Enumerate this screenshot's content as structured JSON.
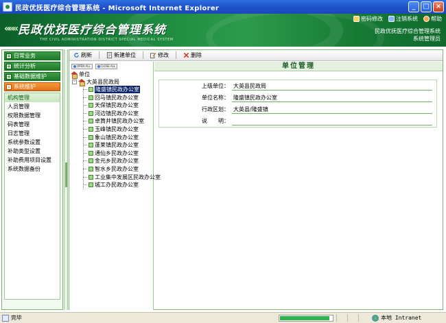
{
  "window": {
    "title": "民政优抚医疗综合管理系统 - Microsoft Internet Explorer"
  },
  "banner": {
    "title": "民政优抚医疗综合管理系统",
    "subtitle": "THE CIVIL ADMINISTRATION DISTRICT SPECIAL MEDICAL SYSTEM",
    "links": [
      {
        "label": "密码修改",
        "icon": "key-icon"
      },
      {
        "label": "注销系统",
        "icon": "logout-icon"
      },
      {
        "label": "帮助",
        "icon": "help-icon"
      }
    ],
    "system_name": "民政优抚医疗综合管理系统",
    "user": "系统管理员"
  },
  "leftnav": {
    "menus": [
      {
        "label": "日常业务",
        "active": false
      },
      {
        "label": "统计分析",
        "active": false
      },
      {
        "label": "基础数据维护",
        "active": false
      },
      {
        "label": "系统维护",
        "active": true
      }
    ],
    "subitems": [
      "机构管理",
      "人员管理",
      "权限数据管理",
      "码表管理",
      "日志管理",
      "系统参数设置",
      "补助类型设置",
      "补助费用项目设置",
      "系统数据备份"
    ]
  },
  "toolbar": {
    "refresh": "刷新",
    "new_unit": "新建单位",
    "edit": "修改",
    "delete": "删除"
  },
  "tree": {
    "open_all": "OPEN ALL",
    "close_all": "CLOSE ALL",
    "root": "单位",
    "county": "大英县民政局",
    "nodes": [
      "隆盛镇民政办公室",
      "回马镇民政办公室",
      "天保镇民政办公室",
      "河边镇民政办公室",
      "卓筒井镇民政办公室",
      "玉峰镇民政办公室",
      "象山镇民政办公室",
      "蓬莱镇民政办公室",
      "通仙乡民政办公室",
      "金元乡民政办公室",
      "智水乡民政办公室",
      "工业集中发展区民政办公室",
      "城工办民政办公室"
    ],
    "selected_index": 0
  },
  "detail": {
    "header": "单位管理",
    "fields": [
      {
        "label": "上级单位：",
        "value": "大英县民政局"
      },
      {
        "label": "单位名称：",
        "value": "隆盛镇民政办公室"
      },
      {
        "label": "行政区划：",
        "value": "大英县/隆盛镇"
      },
      {
        "label": "说　　明：",
        "value": ""
      }
    ]
  },
  "status": {
    "text": "完毕",
    "zone": "本地 Intranet",
    "progress_fraction": 0.95
  }
}
